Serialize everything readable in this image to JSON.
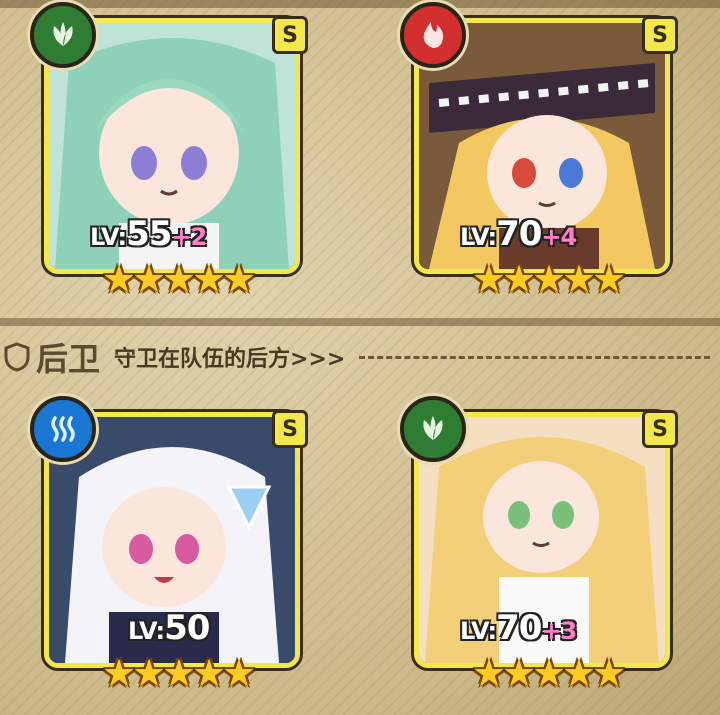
{
  "section": {
    "title": "后卫",
    "subtitle": "守卫在队伍的后方>>>"
  },
  "cards": [
    {
      "element": "leaf-icon",
      "element_color": "#2e7d32",
      "rarity": "S",
      "level_prefix": "LV:",
      "level": "55",
      "bonus": "+2",
      "stars": 5
    },
    {
      "element": "flame-icon",
      "element_color": "#d32f2f",
      "rarity": "S",
      "level_prefix": "LV:",
      "level": "70",
      "bonus": "+4",
      "stars": 5
    },
    {
      "element": "water-icon",
      "element_color": "#1976d2",
      "rarity": "S",
      "level_prefix": "LV:",
      "level": "50",
      "bonus": "",
      "stars": 5
    },
    {
      "element": "leaf-icon",
      "element_color": "#2e7d32",
      "rarity": "S",
      "level_prefix": "LV:",
      "level": "70",
      "bonus": "+3",
      "stars": 5
    }
  ],
  "colors": {
    "frame": "#f2e84a",
    "star": "#ffcc22",
    "bonus": "#ff7fc8"
  }
}
